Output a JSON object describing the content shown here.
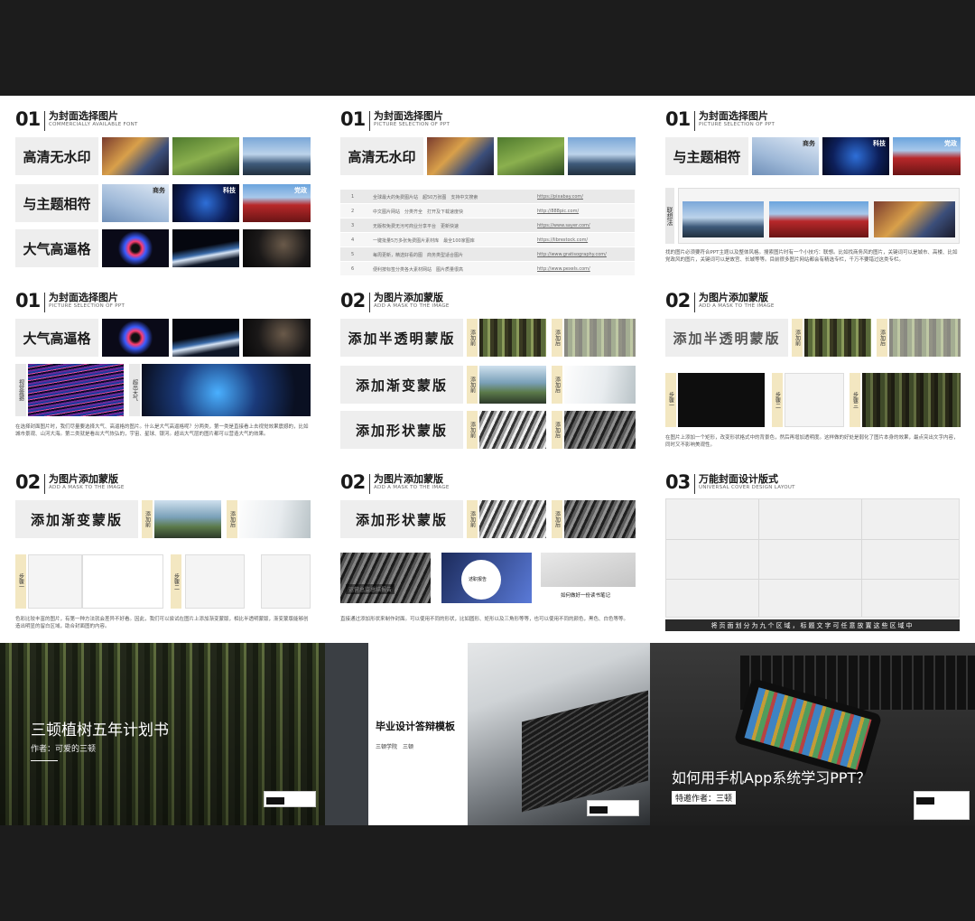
{
  "p1": {
    "num": "01",
    "title": "为封面选择图片",
    "subtitle": "COMMERCIALLY AVAILABLE FONT",
    "labels": [
      "高清无水印",
      "与主题相符",
      "大气高逼格"
    ],
    "tags": [
      "商务",
      "科技",
      "党政"
    ]
  },
  "p2": {
    "num": "01",
    "title": "为封面选择图片",
    "subtitle": "PICTURE SELECTION OF PPT",
    "label": "高清无水印",
    "rows": [
      {
        "n": "1",
        "desc": "全球最大的免费图片站　超50万张图　支持中文搜索",
        "url": "https://pixabay.com/"
      },
      {
        "n": "2",
        "desc": "中文图片网站　分类齐全　打开及下载速度快",
        "url": "http://888pic.com/"
      },
      {
        "n": "3",
        "desc": "无版权免费无污可商业分享平台　更新快速",
        "url": "https://www.sayer.com/"
      },
      {
        "n": "4",
        "desc": "一键批量5万多张免费图片素材库　最全100家图库",
        "url": "https://librestock.com/"
      },
      {
        "n": "5",
        "desc": "每周更新，精选好看的图　商务类型适合图片",
        "url": "http://www.gratisography.com/"
      },
      {
        "n": "6",
        "desc": "便利按标签分类各大素材网站　图片质量很高",
        "url": "http://www.pexels.com/"
      }
    ]
  },
  "p3": {
    "num": "01",
    "title": "为封面选择图片",
    "subtitle": "PICTURE SELECTION OF PPT",
    "label": "与主题相符",
    "tags": [
      "商务",
      "科技",
      "党政"
    ],
    "side": "联想法",
    "text": "找的图片必须要符合PPT主题以及整体风格。搜索图片时有一个小技巧：联想。比如找商务风的图片，关键词可以是城市、高楼、比如党政风的图片，关键词可以是故宫、长城等等。目前很多图片网站都会有精选专栏，千万不要错过这类专栏。"
  },
  "p4": {
    "num": "01",
    "title": "为封面选择图片",
    "subtitle": "PICTURE SELECTION OF PPT",
    "label": "大气高逼格",
    "side1": "视觉震撼",
    "side2": "超出大气",
    "text": "在选择封面图片时，我们尽量要选择大气、高逼格的图片。什么是大气高逼格呢？分两类，第一类是直接看上去视觉效果震撼的，比如城市景观、山河大海。第二类就是看出大气恢弘的，宇宙、星球、银河。超出大气层的图片都可以营造大气的效果。"
  },
  "p5": {
    "num": "02",
    "title": "为图片添加蒙版",
    "subtitle": "ADD A MASK TO THE IMAGE",
    "labels": [
      "添加半透明蒙版",
      "添加渐变蒙版",
      "添加形状蒙版"
    ],
    "before": "添加前",
    "after": "添加后"
  },
  "p6": {
    "num": "02",
    "title": "为图片添加蒙版",
    "subtitle": "ADD A MASK TO THE IMAGE",
    "label": "添加半透明蒙版",
    "before": "添加前",
    "after": "添加后",
    "step1": "步骤一",
    "step2": "步骤二",
    "step3": "步骤三",
    "text": "在图片上添加一个矩形，改变形状格式中的背景色，然后再增加透明度。这样做的好处是弱化了图片本身的效果，最点突出文字内容，同时又不影响美观性。"
  },
  "p7": {
    "num": "02",
    "title": "为图片添加蒙版",
    "subtitle": "ADD A MASK TO THE IMAGE",
    "label": "添加渐变蒙版",
    "before": "添加前",
    "after": "添加后",
    "step1": "步骤一",
    "step2": "步骤二",
    "text": "色彩比较丰富的图片，有第一种方法就会差异不好看。因此，我们可以尝试在图片上添加渐变蒙版，相比半透明蒙版，渐变蒙版能够创造出明显的留白区域，助合封面图的内容。"
  },
  "p8": {
    "num": "02",
    "title": "为图片添加蒙版",
    "subtitle": "ADD A MASK TO THE IMAGE",
    "label": "添加形状蒙版",
    "before": "添加前",
    "after": "添加后",
    "card1": "运营总监总结报告",
    "card2": "述职报告",
    "card3": "如何做好一份读书笔记",
    "text": "直接通过添加形状来制作封面。可以使用不同的形状，比如圆形、矩形以及三角形等等，也可以使用不同的颜色，黑色、白色等等。"
  },
  "p9": {
    "num": "03",
    "title": "万能封面设计版式",
    "subtitle": "UNIVERSAL COVER DESIGN LAYOUT",
    "caption": "将页面划分为九个区域，标题文字可任意放置这些区域中"
  },
  "b1": {
    "title": "三顿植树五年计划书",
    "author": "作者：可爱的三顿"
  },
  "b2": {
    "title": "毕业设计答辩模板",
    "sub": "三顿学院　三顿"
  },
  "b3": {
    "title": "如何用手机App系统学习PPT？",
    "author": "特邀作者：三顿"
  }
}
